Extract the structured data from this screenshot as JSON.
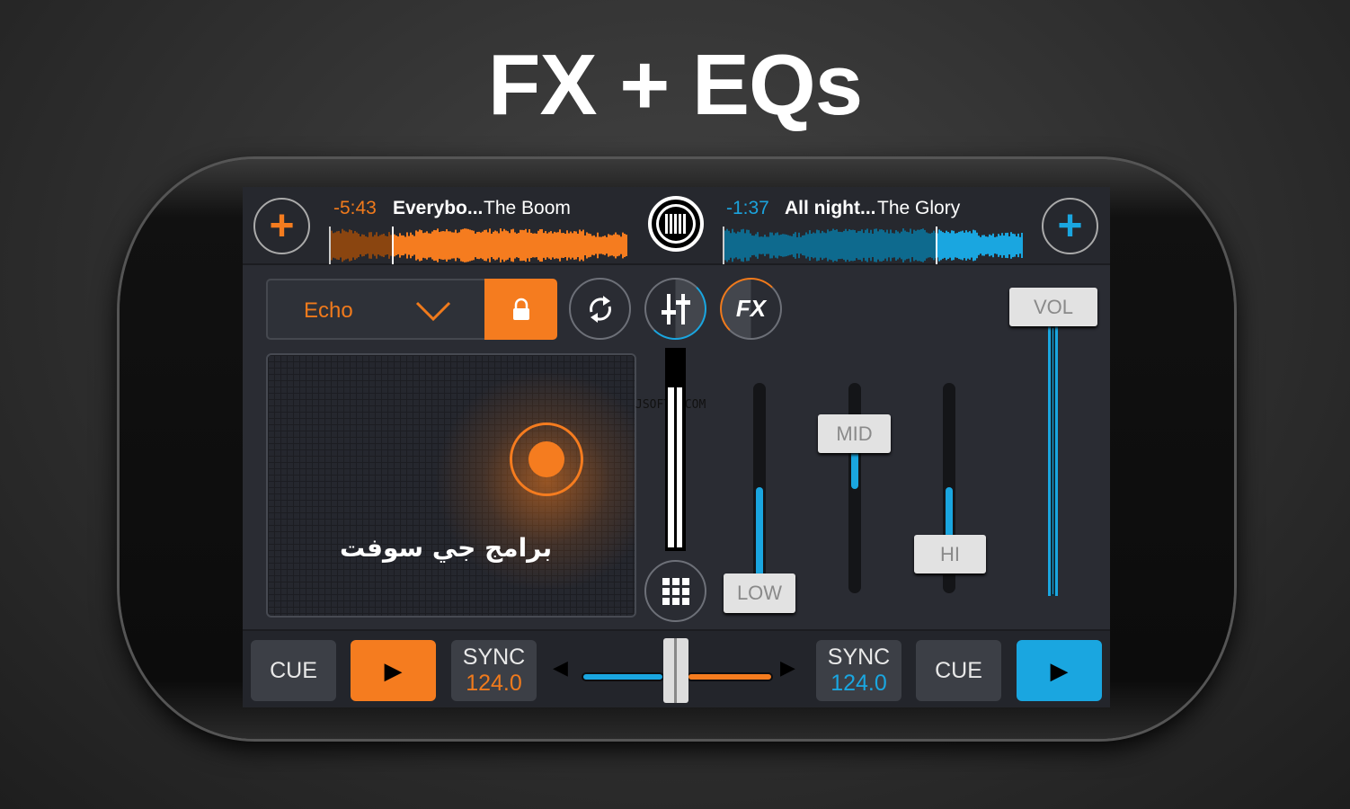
{
  "title": "FX + EQs",
  "deck_left": {
    "time": "-5:43",
    "track_title": "Everybo...",
    "artist": "The Boom",
    "color": "#f57c1f",
    "progress": 0.21
  },
  "deck_right": {
    "time": "-1:37",
    "track_title": "All night...",
    "artist": "The Glory",
    "color": "#1aa6e0",
    "progress": 0.71
  },
  "fx": {
    "selected": "Echo"
  },
  "icons": {
    "add": "plus-icon",
    "logo": "vinyl-logo-icon",
    "lock": "lock-icon",
    "loop": "loop-icon",
    "mixer": "mixer-sliders-icon",
    "fx": "FX",
    "grid": "grid-icon"
  },
  "eq": {
    "low_label": "LOW",
    "mid_label": "MID",
    "hi_label": "HI",
    "vol_label": "VOL",
    "low": 0.05,
    "mid": 0.8,
    "hi": 0.3,
    "vol": 1.0
  },
  "bottom": {
    "cue_left": "CUE",
    "cue_right": "CUE",
    "sync_label": "SYNC",
    "bpm_left": "124.0",
    "bpm_right": "124.0",
    "crossfader": 0.5
  },
  "watermark": {
    "arabic": "برامج جي سوفت",
    "site": "JSOFTJ.COM"
  }
}
